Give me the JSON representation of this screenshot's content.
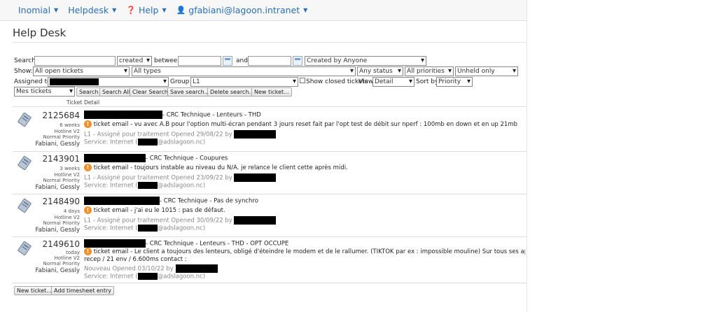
{
  "nav": {
    "inomial": "Inomial",
    "helpdesk": "Helpdesk",
    "help": "Help",
    "user": "gfabiani@lagoon.intranet"
  },
  "page_title": "Help Desk",
  "search": {
    "label": "Search",
    "date_field": "created",
    "between_label": "between",
    "and_label": "and",
    "created_by": "Created by Anyone"
  },
  "filters": {
    "show_label": "Show:",
    "show_value": "All open tickets",
    "types": "All types",
    "status": "Any status",
    "priorities": "All priorities",
    "held": "Unheld only",
    "assigned_label": "Assigned to",
    "group_label": "Group",
    "group_value": "L1",
    "closed_label": "Show closed tickets",
    "view_label": "View",
    "view_value": "Detail",
    "sort_label": "Sort by",
    "sort_value": "Priority",
    "saved_search": "Mes tickets"
  },
  "buttons": {
    "search": "Search",
    "search_all": "Search All",
    "clear": "Clear Search",
    "save": "Save search...",
    "delete": "Delete search...",
    "new_ticket": "New ticket...",
    "new_ticket_bottom": "New ticket...",
    "add_timesheet": "Add timesheet entry"
  },
  "columns": {
    "ticket": "Ticket",
    "detail": "Detail"
  },
  "tickets": [
    {
      "id": "2125684",
      "age": "6 weeks",
      "queue": "Hotline V2",
      "priority": "Normal Priority",
      "user": "Fabiani, Gessly",
      "subject": "- CRC Technique - Lenteurs - THD",
      "body": "ticket email - vu avec A.B pour l'option multi-écran pendant 3 jours reset fait par l'opt test de débit sur nperf : 100mb en down et en up 21mb",
      "body2": "",
      "status": "L1 - Assigné pour traitement Opened 29/08/22 by",
      "service_prefix": "Service: Internet (",
      "service_suffix": "@adslagoon.nc)"
    },
    {
      "id": "2143901",
      "age": "3 weeks",
      "queue": "Hotline V2",
      "priority": "Normal Priority",
      "user": "Fabiani, Gessly",
      "subject": "- CRC Technique - Coupures",
      "body": "ticket email - toujours instable au niveau du N/A. je relance le client cette après midi.",
      "body2": "",
      "status": "L1 - Assigné pour traitement Opened 23/09/22 by",
      "service_prefix": "Service: Internet (",
      "service_suffix": "@adslagoon.nc)"
    },
    {
      "id": "2148490",
      "age": "4 days",
      "queue": "Hotline V2",
      "priority": "Normal Priority",
      "user": "Fabiani, Gessly",
      "subject": "- CRC Technique - Pas de synchro",
      "body": "ticket email - j'ai eu le 1015 : pas de défaut.",
      "body2": "",
      "status": "L1 - Assigné pour traitement Opened 30/09/22 by",
      "service_prefix": "Service: Internet (",
      "service_suffix": "@adslagoon.nc)"
    },
    {
      "id": "2149610",
      "age": "today",
      "queue": "Hotline V2",
      "priority": "Normal Priority",
      "user": "Fabiani, Gessly",
      "subject": "- CRC Technique - Lenteurs - THD - OPT OCCUPE",
      "body": "ticket email - Le client a toujours des lenteurs, obligé d'éteindre le modem et de le rallumer. (TIKTOK par ex : impossible mouline) Sur tous ses appareils. Télépl",
      "body2": "recep / 21 env / 6.600ms contact :",
      "status": "Nouveau Opened 03/10/22 by",
      "service_prefix": "Service: Internet (",
      "service_suffix": "@adslagoon.nc)"
    }
  ]
}
